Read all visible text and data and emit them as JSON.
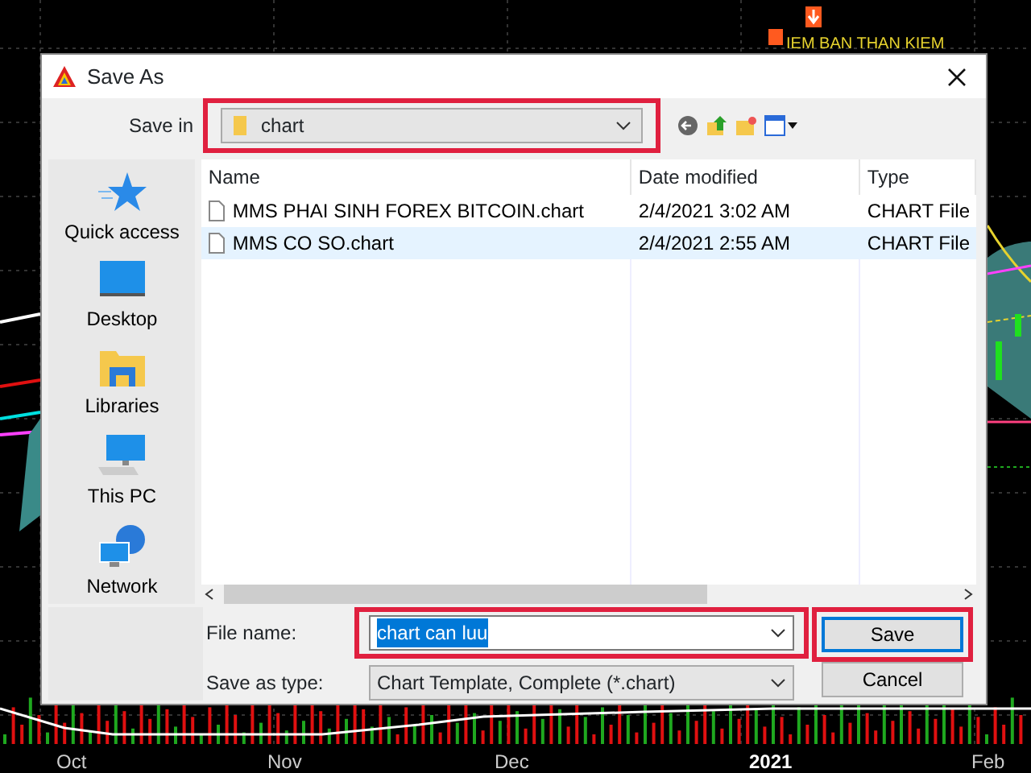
{
  "background_chart": {
    "top_label": "IEM BAN THAN KIEM",
    "x_labels": [
      {
        "label": "Oct",
        "bold": false
      },
      {
        "label": "Nov",
        "bold": false
      },
      {
        "label": "Dec",
        "bold": false
      },
      {
        "label": "2021",
        "bold": true
      },
      {
        "label": "Feb",
        "bold": false
      }
    ]
  },
  "dialog": {
    "title": "Save As"
  },
  "save_in": {
    "label": "Save in",
    "folder": "chart",
    "highlighted": true
  },
  "places": [
    {
      "label": "Quick access"
    },
    {
      "label": "Desktop"
    },
    {
      "label": "Libraries"
    },
    {
      "label": "This PC"
    },
    {
      "label": "Network"
    }
  ],
  "columns": [
    "Name",
    "Date modified",
    "Type"
  ],
  "files": [
    {
      "name": "MMS PHAI SINH FOREX BITCOIN.chart",
      "date": "2/4/2021 3:02 AM",
      "type": "CHART File",
      "selected": false
    },
    {
      "name": "MMS CO SO.chart",
      "date": "2/4/2021 2:55 AM",
      "type": "CHART File",
      "selected": true
    }
  ],
  "file_name": {
    "label": "File name:",
    "value": "chart can luu",
    "text_selected": true,
    "highlighted": true
  },
  "save_as_type": {
    "label": "Save as type:",
    "value": "Chart Template, Complete (*.chart)"
  },
  "buttons": [
    {
      "label": "Save",
      "default": true,
      "highlighted": true
    },
    {
      "label": "Cancel",
      "default": false,
      "highlighted": false
    }
  ]
}
